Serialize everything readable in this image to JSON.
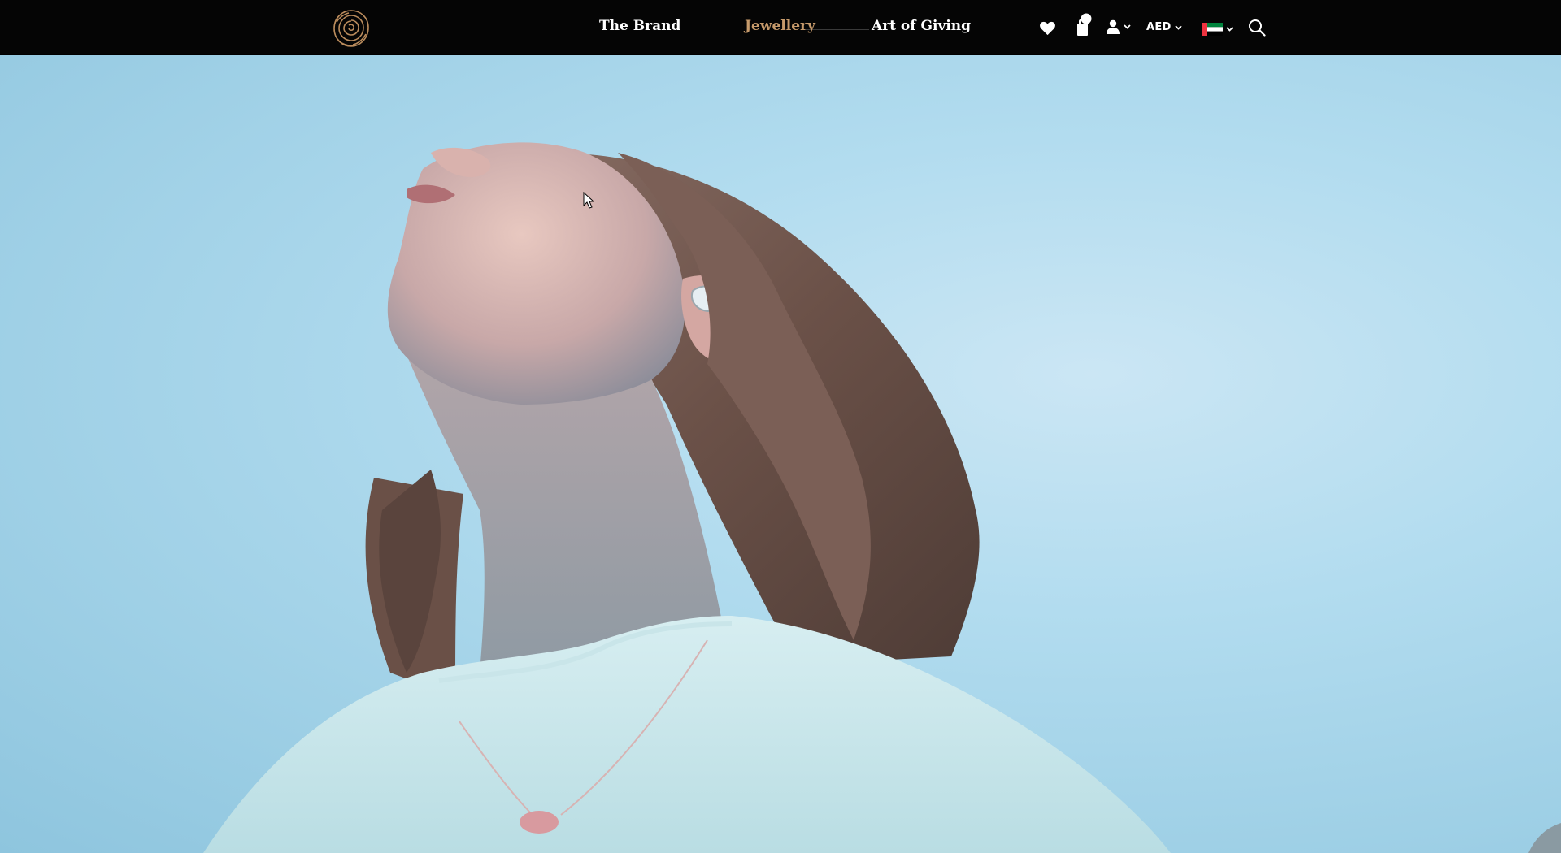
{
  "header": {
    "logo_icon": "rose-logo-icon",
    "nav": [
      {
        "label": "The Brand",
        "active": false
      },
      {
        "label": "Jewellery",
        "active": true
      },
      {
        "label": "Art of Giving",
        "active": false
      }
    ],
    "icons": {
      "wishlist": "heart-icon",
      "cart": "shopping-bag-icon",
      "account": "user-icon",
      "flag": "uae-flag-icon",
      "search": "search-icon"
    },
    "currency": "AED"
  },
  "hero": {
    "media": "hero-video-woman-looking-up-sky"
  },
  "colors": {
    "topbar_bg": "#050505",
    "nav_text": "#ffffff",
    "nav_active": "#c69a6b",
    "sky": "#a8d6ec"
  }
}
